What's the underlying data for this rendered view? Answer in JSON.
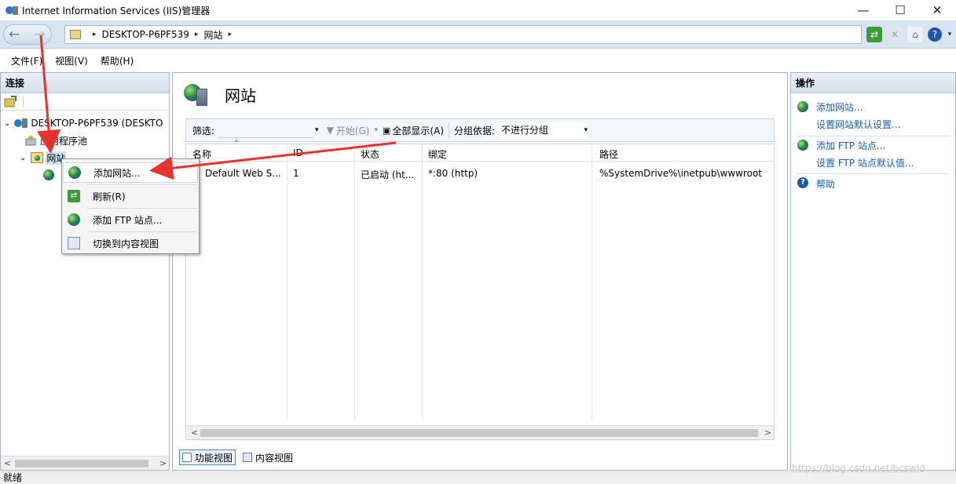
{
  "window": {
    "title": "Internet Information Services (IIS)管理器",
    "minimize": "—",
    "maximize": "☐",
    "close": "✕"
  },
  "address": {
    "back": "←",
    "forward": "→",
    "crumbs": [
      "DESKTOP-P6PF539",
      "网站"
    ],
    "separator": "▸"
  },
  "toolbar_icons": [
    "refresh-icon",
    "stop-icon",
    "home-icon",
    "help-icon"
  ],
  "menu": [
    "文件(F)",
    "视图(V)",
    "帮助(H)"
  ],
  "left": {
    "header": "连接",
    "tree": {
      "server": "DESKTOP-P6PF539 (DESKTO",
      "app_pools": "应用程序池",
      "sites": "网站"
    },
    "scroll_left": "<",
    "scroll_right": ">"
  },
  "center": {
    "title": "网站",
    "filter": {
      "label": "筛选:",
      "start": "开始(G)",
      "show_all": "全部显示(A)",
      "group_by": "分组依据:",
      "group_value": "不进行分组"
    },
    "columns": [
      "名称",
      "ID",
      "状态",
      "绑定",
      "路径"
    ],
    "rows": [
      [
        "Default Web S...",
        "1",
        "已启动 (ht...",
        "*:80 (http)",
        "%SystemDrive%\\inetpub\\wwwroot"
      ]
    ],
    "scroll_left": "<",
    "scroll_right": ">",
    "tabs": [
      "功能视图",
      "内容视图"
    ]
  },
  "right": {
    "header": "操作",
    "actions": {
      "add_site": "添加网站...",
      "site_defaults": "设置网站默认设置...",
      "add_ftp": "添加 FTP 站点...",
      "ftp_defaults": "设置 FTP 站点默认值...",
      "help": "帮助"
    }
  },
  "context_menu": [
    "添加网站...",
    "刷新(R)",
    "添加 FTP 站点...",
    "切换到内容视图"
  ],
  "status": "就绪",
  "watermark": "https://blog.csdn.net/bcswld",
  "colors": {
    "link": "#1a5fb4",
    "annotation_arrow": "#e8322e"
  }
}
